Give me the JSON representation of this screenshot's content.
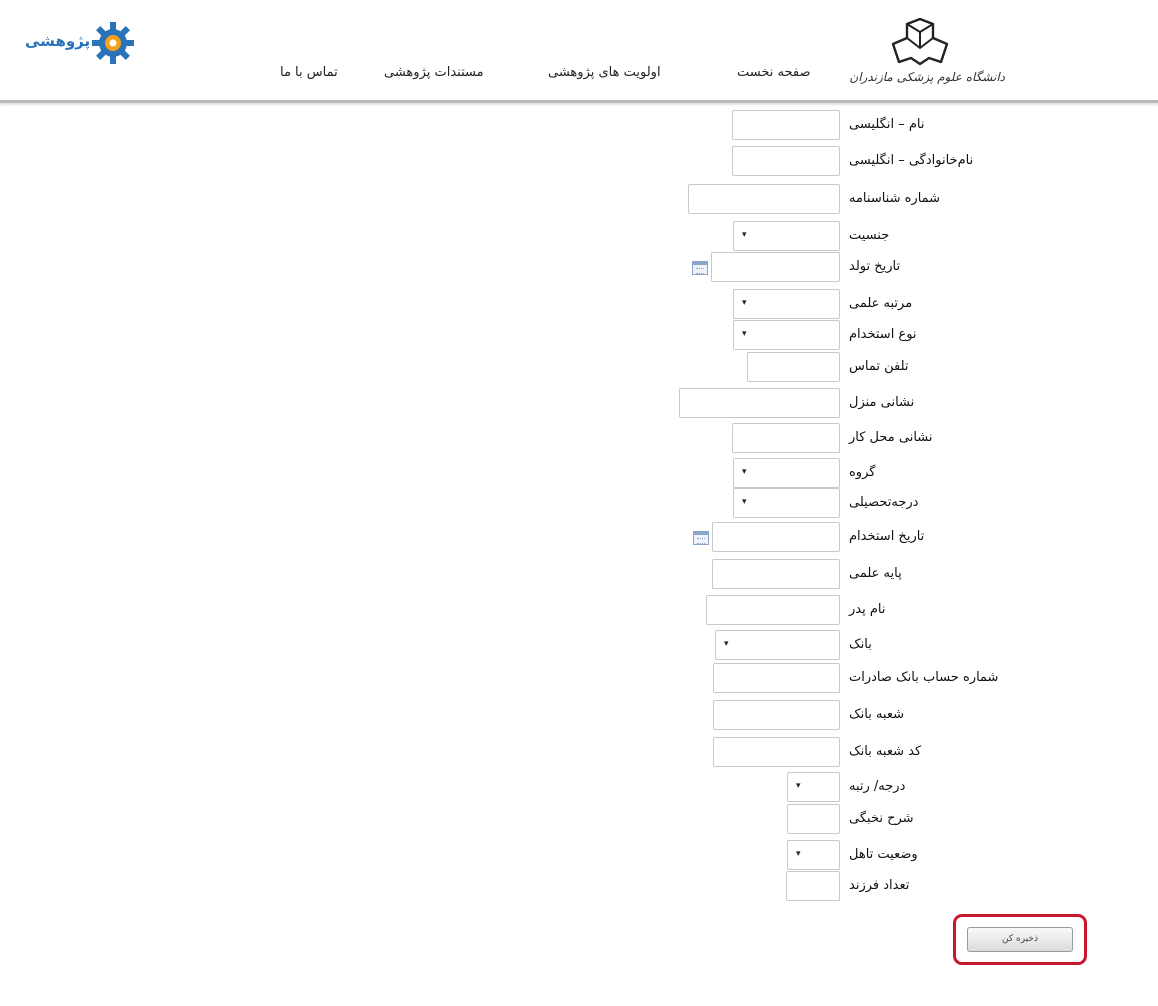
{
  "header": {
    "university_name": "دانشگاه علوم پزشکی مازندران",
    "brand": "پژوهشی",
    "nav": [
      {
        "label": "صفحه نخست"
      },
      {
        "label": "اولویت های پژوهشی"
      },
      {
        "label": "مستندات پژوهشی"
      },
      {
        "label": "تماس با ما"
      }
    ]
  },
  "form": {
    "fields": [
      {
        "label": "نام – انگلیسی",
        "type": "text",
        "value": ""
      },
      {
        "label": "نام‌خانوادگی – انگلیسی",
        "type": "text",
        "value": ""
      },
      {
        "label": "شماره شناسنامه",
        "type": "text",
        "value": ""
      },
      {
        "label": "جنسیت",
        "type": "select",
        "value": ""
      },
      {
        "label": "تاریخ تولد",
        "type": "date",
        "value": ""
      },
      {
        "label": "مرتبه علمی",
        "type": "select",
        "value": ""
      },
      {
        "label": "نوع استخدام",
        "type": "select",
        "value": ""
      },
      {
        "label": "تلفن تماس",
        "type": "text",
        "value": ""
      },
      {
        "label": "نشانی منزل",
        "type": "text",
        "value": ""
      },
      {
        "label": "نشانی محل کار",
        "type": "text",
        "value": ""
      },
      {
        "label": "گروه",
        "type": "select",
        "value": ""
      },
      {
        "label": "درجه‌تحصیلی",
        "type": "select",
        "value": ""
      },
      {
        "label": "تاریخ استخدام",
        "type": "date",
        "value": ""
      },
      {
        "label": "پایه علمی",
        "type": "text",
        "value": ""
      },
      {
        "label": "نام پدر",
        "type": "text",
        "value": ""
      },
      {
        "label": "بانک",
        "type": "select",
        "value": ""
      },
      {
        "label": "شماره حساب بانک صادرات",
        "type": "text",
        "value": ""
      },
      {
        "label": "شعبه بانک",
        "type": "text",
        "value": ""
      },
      {
        "label": "کد شعبه بانک",
        "type": "text",
        "value": ""
      },
      {
        "label": "درجه/ رتبه",
        "type": "select",
        "value": ""
      },
      {
        "label": "شرح نخبگی",
        "type": "text",
        "value": ""
      },
      {
        "label": "وضعیت تاهل",
        "type": "select",
        "value": ""
      },
      {
        "label": "تعداد فرزند",
        "type": "text",
        "value": ""
      }
    ],
    "save_label": "ذخیره کن"
  },
  "colors": {
    "highlight": "#c8182c",
    "header_rule": "#b9b9b9",
    "brand": "#2a73b8"
  },
  "icons": {
    "select_arrow": "▾",
    "calendar": "calendar-icon"
  }
}
